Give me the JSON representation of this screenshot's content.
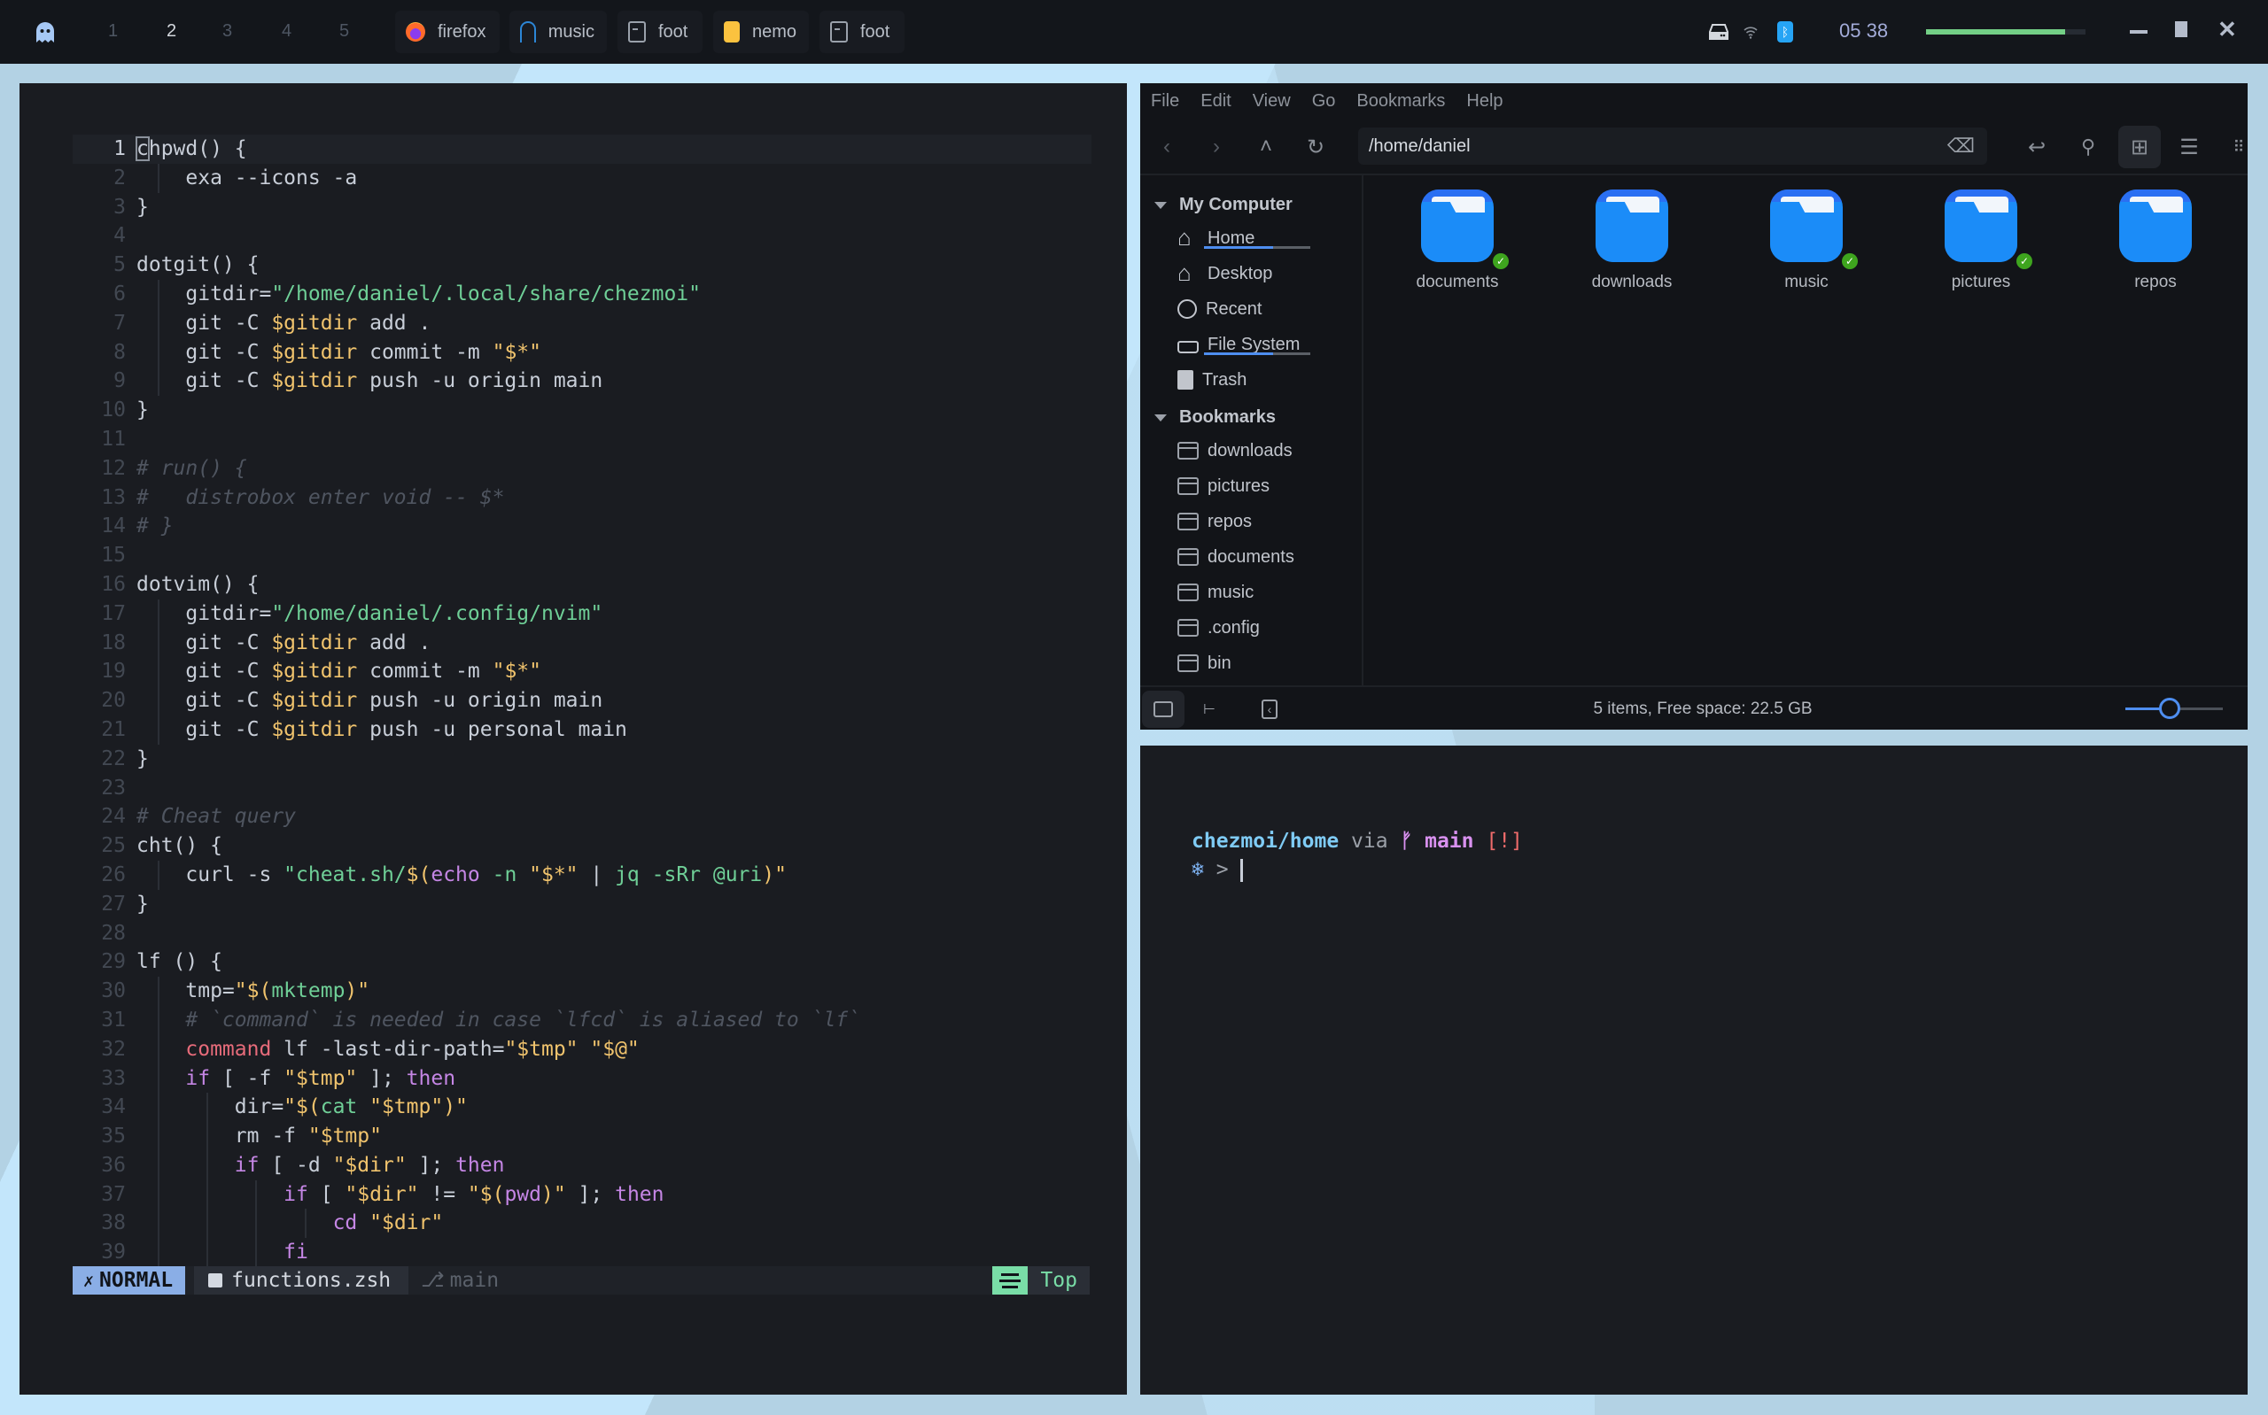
{
  "topbar": {
    "launcher_icon": "ghost-icon",
    "workspaces": [
      {
        "label": "1",
        "active": false
      },
      {
        "label": "2",
        "active": true
      },
      {
        "label": "3",
        "active": false
      },
      {
        "label": "4",
        "active": false
      },
      {
        "label": "5",
        "active": false
      }
    ],
    "tasks": [
      {
        "label": "firefox",
        "icon": "firefox-icon"
      },
      {
        "label": "music",
        "icon": "headphones-icon"
      },
      {
        "label": "foot",
        "icon": "terminal-icon"
      },
      {
        "label": "nemo",
        "icon": "nemo-folder-icon"
      },
      {
        "label": "foot",
        "icon": "terminal-icon"
      }
    ],
    "tray_icons": [
      "drive-icon",
      "wifi-icon",
      "bluetooth-icon"
    ],
    "clock": "05 38",
    "volume_percent": 87,
    "window_controls": [
      "minimize",
      "maximize",
      "close"
    ]
  },
  "editor": {
    "lines": [
      {
        "n": "1",
        "indent": 0,
        "tokens": [
          {
            "t": "chpwd() {",
            "c": "c-wht"
          }
        ]
      },
      {
        "n": "2",
        "indent": 1,
        "tokens": [
          {
            "t": "exa --icons -a",
            "c": "c-wht"
          }
        ]
      },
      {
        "n": "3",
        "indent": 0,
        "tokens": [
          {
            "t": "}",
            "c": "c-wht"
          }
        ]
      },
      {
        "n": "4",
        "indent": 0,
        "tokens": []
      },
      {
        "n": "5",
        "indent": 0,
        "tokens": [
          {
            "t": "dotgit() {",
            "c": "c-wht"
          }
        ]
      },
      {
        "n": "6",
        "indent": 1,
        "tokens": [
          {
            "t": "gitdir=",
            "c": "c-wht"
          },
          {
            "t": "\"/home/daniel/.local/share/chezmoi\"",
            "c": "c-str"
          }
        ]
      },
      {
        "n": "7",
        "indent": 1,
        "tokens": [
          {
            "t": "git -C ",
            "c": "c-wht"
          },
          {
            "t": "$gitdir",
            "c": "c-var"
          },
          {
            "t": " add .",
            "c": "c-wht"
          }
        ]
      },
      {
        "n": "8",
        "indent": 1,
        "tokens": [
          {
            "t": "git -C ",
            "c": "c-wht"
          },
          {
            "t": "$gitdir",
            "c": "c-var"
          },
          {
            "t": " commit -m ",
            "c": "c-wht"
          },
          {
            "t": "\"$*\"",
            "c": "c-var"
          }
        ]
      },
      {
        "n": "9",
        "indent": 1,
        "tokens": [
          {
            "t": "git -C ",
            "c": "c-wht"
          },
          {
            "t": "$gitdir",
            "c": "c-var"
          },
          {
            "t": " push -u origin main",
            "c": "c-wht"
          }
        ]
      },
      {
        "n": "10",
        "indent": 0,
        "tokens": [
          {
            "t": "}",
            "c": "c-wht"
          }
        ]
      },
      {
        "n": "11",
        "indent": 0,
        "tokens": []
      },
      {
        "n": "12",
        "indent": 0,
        "tokens": [
          {
            "t": "# run() {",
            "c": "c-cmt"
          }
        ]
      },
      {
        "n": "13",
        "indent": 0,
        "tokens": [
          {
            "t": "#   distrobox enter void -- $*",
            "c": "c-cmt"
          }
        ]
      },
      {
        "n": "14",
        "indent": 0,
        "tokens": [
          {
            "t": "# }",
            "c": "c-cmt"
          }
        ]
      },
      {
        "n": "15",
        "indent": 0,
        "tokens": []
      },
      {
        "n": "16",
        "indent": 0,
        "tokens": [
          {
            "t": "dotvim() {",
            "c": "c-wht"
          }
        ]
      },
      {
        "n": "17",
        "indent": 1,
        "tokens": [
          {
            "t": "gitdir=",
            "c": "c-wht"
          },
          {
            "t": "\"/home/daniel/.config/nvim\"",
            "c": "c-str"
          }
        ]
      },
      {
        "n": "18",
        "indent": 1,
        "tokens": [
          {
            "t": "git -C ",
            "c": "c-wht"
          },
          {
            "t": "$gitdir",
            "c": "c-var"
          },
          {
            "t": " add .",
            "c": "c-wht"
          }
        ]
      },
      {
        "n": "19",
        "indent": 1,
        "tokens": [
          {
            "t": "git -C ",
            "c": "c-wht"
          },
          {
            "t": "$gitdir",
            "c": "c-var"
          },
          {
            "t": " commit -m ",
            "c": "c-wht"
          },
          {
            "t": "\"$*\"",
            "c": "c-var"
          }
        ]
      },
      {
        "n": "20",
        "indent": 1,
        "tokens": [
          {
            "t": "git -C ",
            "c": "c-wht"
          },
          {
            "t": "$gitdir",
            "c": "c-var"
          },
          {
            "t": " push -u origin main",
            "c": "c-wht"
          }
        ]
      },
      {
        "n": "21",
        "indent": 1,
        "tokens": [
          {
            "t": "git -C ",
            "c": "c-wht"
          },
          {
            "t": "$gitdir",
            "c": "c-var"
          },
          {
            "t": " push -u personal main",
            "c": "c-wht"
          }
        ]
      },
      {
        "n": "22",
        "indent": 0,
        "tokens": [
          {
            "t": "}",
            "c": "c-wht"
          }
        ]
      },
      {
        "n": "23",
        "indent": 0,
        "tokens": []
      },
      {
        "n": "24",
        "indent": 0,
        "tokens": [
          {
            "t": "# Cheat query",
            "c": "c-cmt"
          }
        ]
      },
      {
        "n": "25",
        "indent": 0,
        "tokens": [
          {
            "t": "cht() {",
            "c": "c-wht"
          }
        ]
      },
      {
        "n": "26",
        "indent": 1,
        "tokens": [
          {
            "t": "curl -s ",
            "c": "c-wht"
          },
          {
            "t": "\"cheat.sh/",
            "c": "c-str"
          },
          {
            "t": "$(",
            "c": "c-var"
          },
          {
            "t": "echo",
            "c": "c-kw"
          },
          {
            "t": " -n ",
            "c": "c-str"
          },
          {
            "t": "\"$*\"",
            "c": "c-var"
          },
          {
            "t": " | ",
            "c": "c-wht"
          },
          {
            "t": "jq -sRr @uri",
            "c": "c-str"
          },
          {
            "t": ")\"",
            "c": "c-var"
          }
        ]
      },
      {
        "n": "27",
        "indent": 0,
        "tokens": [
          {
            "t": "}",
            "c": "c-wht"
          }
        ]
      },
      {
        "n": "28",
        "indent": 0,
        "tokens": []
      },
      {
        "n": "29",
        "indent": 0,
        "tokens": [
          {
            "t": "lf () {",
            "c": "c-wht"
          }
        ]
      },
      {
        "n": "30",
        "indent": 1,
        "tokens": [
          {
            "t": "tmp=",
            "c": "c-wht"
          },
          {
            "t": "\"$(",
            "c": "c-var"
          },
          {
            "t": "mktemp",
            "c": "c-str"
          },
          {
            "t": ")\"",
            "c": "c-var"
          }
        ]
      },
      {
        "n": "31",
        "indent": 1,
        "tokens": [
          {
            "t": "# `command` is needed in case `lfcd` is aliased to `lf`",
            "c": "c-cmt"
          }
        ]
      },
      {
        "n": "32",
        "indent": 1,
        "tokens": [
          {
            "t": "command",
            "c": "c-red"
          },
          {
            "t": " lf -last-dir-path=",
            "c": "c-wht"
          },
          {
            "t": "\"$tmp\"",
            "c": "c-var"
          },
          {
            "t": " ",
            "c": "c-wht"
          },
          {
            "t": "\"$@\"",
            "c": "c-var"
          }
        ]
      },
      {
        "n": "33",
        "indent": 1,
        "tokens": [
          {
            "t": "if",
            "c": "c-kw"
          },
          {
            "t": " [ -f ",
            "c": "c-wht"
          },
          {
            "t": "\"$tmp\"",
            "c": "c-var"
          },
          {
            "t": " ]; ",
            "c": "c-wht"
          },
          {
            "t": "then",
            "c": "c-kw"
          }
        ]
      },
      {
        "n": "34",
        "indent": 2,
        "tokens": [
          {
            "t": "dir=",
            "c": "c-wht"
          },
          {
            "t": "\"$(",
            "c": "c-var"
          },
          {
            "t": "cat ",
            "c": "c-str"
          },
          {
            "t": "\"$tmp\")\"",
            "c": "c-var"
          }
        ]
      },
      {
        "n": "35",
        "indent": 2,
        "tokens": [
          {
            "t": "rm -f ",
            "c": "c-wht"
          },
          {
            "t": "\"$tmp\"",
            "c": "c-var"
          }
        ]
      },
      {
        "n": "36",
        "indent": 2,
        "tokens": [
          {
            "t": "if",
            "c": "c-kw"
          },
          {
            "t": " [ -d ",
            "c": "c-wht"
          },
          {
            "t": "\"$dir\"",
            "c": "c-var"
          },
          {
            "t": " ]; ",
            "c": "c-wht"
          },
          {
            "t": "then",
            "c": "c-kw"
          }
        ]
      },
      {
        "n": "37",
        "indent": 3,
        "tokens": [
          {
            "t": "if",
            "c": "c-kw"
          },
          {
            "t": " [ ",
            "c": "c-wht"
          },
          {
            "t": "\"$dir\"",
            "c": "c-var"
          },
          {
            "t": " != ",
            "c": "c-wht"
          },
          {
            "t": "\"$(",
            "c": "c-var"
          },
          {
            "t": "pwd",
            "c": "c-kw"
          },
          {
            "t": ")\"",
            "c": "c-var"
          },
          {
            "t": " ]; ",
            "c": "c-wht"
          },
          {
            "t": "then",
            "c": "c-kw"
          }
        ]
      },
      {
        "n": "38",
        "indent": 4,
        "tokens": [
          {
            "t": "cd",
            "c": "c-kw"
          },
          {
            "t": " ",
            "c": "c-wht"
          },
          {
            "t": "\"$dir\"",
            "c": "c-var"
          }
        ]
      },
      {
        "n": "39",
        "indent": 3,
        "tokens": [
          {
            "t": "fi",
            "c": "c-kw"
          }
        ]
      }
    ],
    "statusline": {
      "mode": "NORMAL",
      "filename": "functions.zsh",
      "branch": "main",
      "position": "Top"
    }
  },
  "filemanager": {
    "menu": [
      "File",
      "Edit",
      "View",
      "Go",
      "Bookmarks",
      "Help"
    ],
    "path": "/home/daniel",
    "sidebar": {
      "sections": [
        {
          "title": "My Computer",
          "items": [
            {
              "label": "Home",
              "icon": "home-icon",
              "usage_percent": 65
            },
            {
              "label": "Desktop",
              "icon": "home-icon"
            },
            {
              "label": "Recent",
              "icon": "clock-icon"
            },
            {
              "label": "File System",
              "icon": "drive-icon",
              "usage_percent": 65
            },
            {
              "label": "Trash",
              "icon": "trash-icon"
            }
          ]
        },
        {
          "title": "Bookmarks",
          "items": [
            {
              "label": "downloads",
              "icon": "folder-icon"
            },
            {
              "label": "pictures",
              "icon": "folder-icon"
            },
            {
              "label": "repos",
              "icon": "folder-icon"
            },
            {
              "label": "documents",
              "icon": "folder-icon"
            },
            {
              "label": "music",
              "icon": "folder-icon"
            },
            {
              "label": ".config",
              "icon": "folder-icon"
            },
            {
              "label": "bin",
              "icon": "folder-icon"
            }
          ]
        }
      ]
    },
    "files": [
      {
        "name": "documents",
        "synced": true
      },
      {
        "name": "downloads",
        "synced": false
      },
      {
        "name": "music",
        "synced": true
      },
      {
        "name": "pictures",
        "synced": true
      },
      {
        "name": "repos",
        "synced": false
      }
    ],
    "status": "5 items, Free space: 22.5 GB",
    "zoom_percent": 45
  },
  "terminal": {
    "dir": "chezmoi/home",
    "via": "via",
    "branch_icon": "ᚠ",
    "branch": "main",
    "status_flag": "[!]",
    "prompt_icon": "❄",
    "prompt_char": ">"
  }
}
